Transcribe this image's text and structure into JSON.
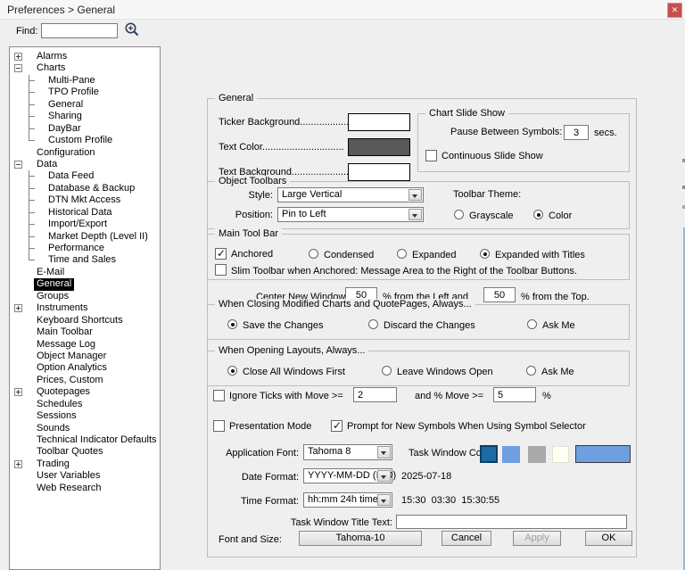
{
  "window": {
    "title": "Preferences > General",
    "close_glyph": "✕"
  },
  "find": {
    "label": "Find:",
    "value": ""
  },
  "tree": {
    "items": [
      {
        "label": "Alarms",
        "toggle": "plus"
      },
      {
        "label": "Charts",
        "toggle": "minus"
      },
      {
        "label": "Multi-Pane",
        "branch": "mid"
      },
      {
        "label": "TPO Profile",
        "branch": "mid"
      },
      {
        "label": "General",
        "branch": "mid"
      },
      {
        "label": "Sharing",
        "branch": "mid"
      },
      {
        "label": "DayBar",
        "branch": "mid"
      },
      {
        "label": "Custom Profile",
        "branch": "end"
      },
      {
        "label": "Configuration"
      },
      {
        "label": "Data",
        "toggle": "minus"
      },
      {
        "label": "Data Feed",
        "branch": "mid"
      },
      {
        "label": "Database & Backup",
        "branch": "mid"
      },
      {
        "label": "DTN Mkt Access",
        "branch": "mid"
      },
      {
        "label": "Historical Data",
        "branch": "mid"
      },
      {
        "label": "Import/Export",
        "branch": "mid"
      },
      {
        "label": "Market Depth (Level II)",
        "branch": "mid"
      },
      {
        "label": "Performance",
        "branch": "mid"
      },
      {
        "label": "Time and Sales",
        "branch": "end"
      },
      {
        "label": "E-Mail"
      },
      {
        "label": "General",
        "sel": true
      },
      {
        "label": "Groups"
      },
      {
        "label": "Instruments",
        "toggle": "plus"
      },
      {
        "label": "Keyboard Shortcuts"
      },
      {
        "label": "Main Toolbar"
      },
      {
        "label": "Message Log"
      },
      {
        "label": "Object Manager"
      },
      {
        "label": "Option Analytics"
      },
      {
        "label": "Prices, Custom"
      },
      {
        "label": "Quotepages",
        "toggle": "plus"
      },
      {
        "label": "Schedules"
      },
      {
        "label": "Sessions"
      },
      {
        "label": "Sounds"
      },
      {
        "label": "Technical Indicator Defaults"
      },
      {
        "label": "Toolbar Quotes"
      },
      {
        "label": "Trading",
        "toggle": "plus"
      },
      {
        "label": "User Variables"
      },
      {
        "label": "Web Research"
      }
    ]
  },
  "main": {
    "title": "General",
    "colors": {
      "ticker_bg_label": "Ticker Background......................",
      "ticker_bg_color": "#ffffff",
      "text_color_label": "Text Color..............................",
      "text_color_color": "#595959",
      "text_bg_label": "Text Background......................",
      "text_bg_color": "#ffffff"
    },
    "slide_show": {
      "title": "Chart Slide Show",
      "pause_label": "Pause Between Symbols:",
      "pause_value": "3",
      "secs_label": "secs.",
      "continuous": {
        "label": "Continuous Slide Show",
        "checked": false
      }
    },
    "object_toolbars": {
      "title": "Object Toolbars",
      "style_label": "Style:",
      "style_value": "Large Vertical",
      "position_label": "Position:",
      "position_value": "Pin to Left",
      "theme_label": "Toolbar Theme:",
      "theme_options": [
        {
          "label": "Grayscale",
          "selected": false
        },
        {
          "label": "Color",
          "selected": true
        }
      ]
    },
    "main_tool_bar": {
      "title": "Main Tool Bar",
      "anchored": {
        "label": "Anchored",
        "checked": true
      },
      "mode_options": [
        {
          "label": "Condensed",
          "selected": false
        },
        {
          "label": "Expanded",
          "selected": false
        },
        {
          "label": "Expanded with Titles",
          "selected": true
        }
      ],
      "slim": {
        "label": "Slim Toolbar when Anchored: Message Area to the Right of the Toolbar Buttons.",
        "checked": false
      }
    },
    "center_windows": {
      "label": "Center New Windows",
      "left_value": "50",
      "left_label": "% from the Left and",
      "top_value": "50",
      "top_label": "% from the Top."
    },
    "closing": {
      "title": "When Closing Modified Charts and QuotePages, Always...",
      "options": [
        {
          "label": "Save the Changes",
          "selected": true
        },
        {
          "label": "Discard the Changes",
          "selected": false
        },
        {
          "label": "Ask Me",
          "selected": false
        }
      ]
    },
    "opening": {
      "title": "When Opening Layouts, Always...",
      "options": [
        {
          "label": "Close All Windows First",
          "selected": true
        },
        {
          "label": "Leave Windows Open",
          "selected": false
        },
        {
          "label": "Ask Me",
          "selected": false
        }
      ]
    },
    "ignore_ticks": {
      "label": "Ignore Ticks with Move >=",
      "checked": false,
      "move_value": "2",
      "and_label": "and % Move >=",
      "pct_value": "5",
      "pct_label": "%"
    },
    "presentation": {
      "label": "Presentation Mode",
      "checked": false
    },
    "prompt_symbols": {
      "label": "Prompt for New Symbols When Using Symbol Selector",
      "checked": true
    },
    "app_font": {
      "label": "Application Font:",
      "value": "Tahoma 8"
    },
    "task_window_color": {
      "label": "Task Window Color:",
      "swatches": [
        "#1d6ba5",
        "#6f9fe0",
        "#a9a9a9",
        "#fffff2"
      ],
      "wide_swatch": "#6f9fe0"
    },
    "date_format": {
      "label": "Date Format:",
      "value": "YYYY-MM-DD (ISO)",
      "preview": "2025-07-18"
    },
    "time_format": {
      "label": "Time Format:",
      "value": "hh:mm 24h time",
      "preview": "15:30  03:30  15:30:55"
    },
    "task_title": {
      "label": "Task Window Title Text:",
      "value": ""
    },
    "font_size": {
      "label": "Font and Size:",
      "button_label": "Tahoma-10"
    },
    "buttons": {
      "cancel": "Cancel",
      "apply": "Apply",
      "ok": "OK"
    }
  }
}
